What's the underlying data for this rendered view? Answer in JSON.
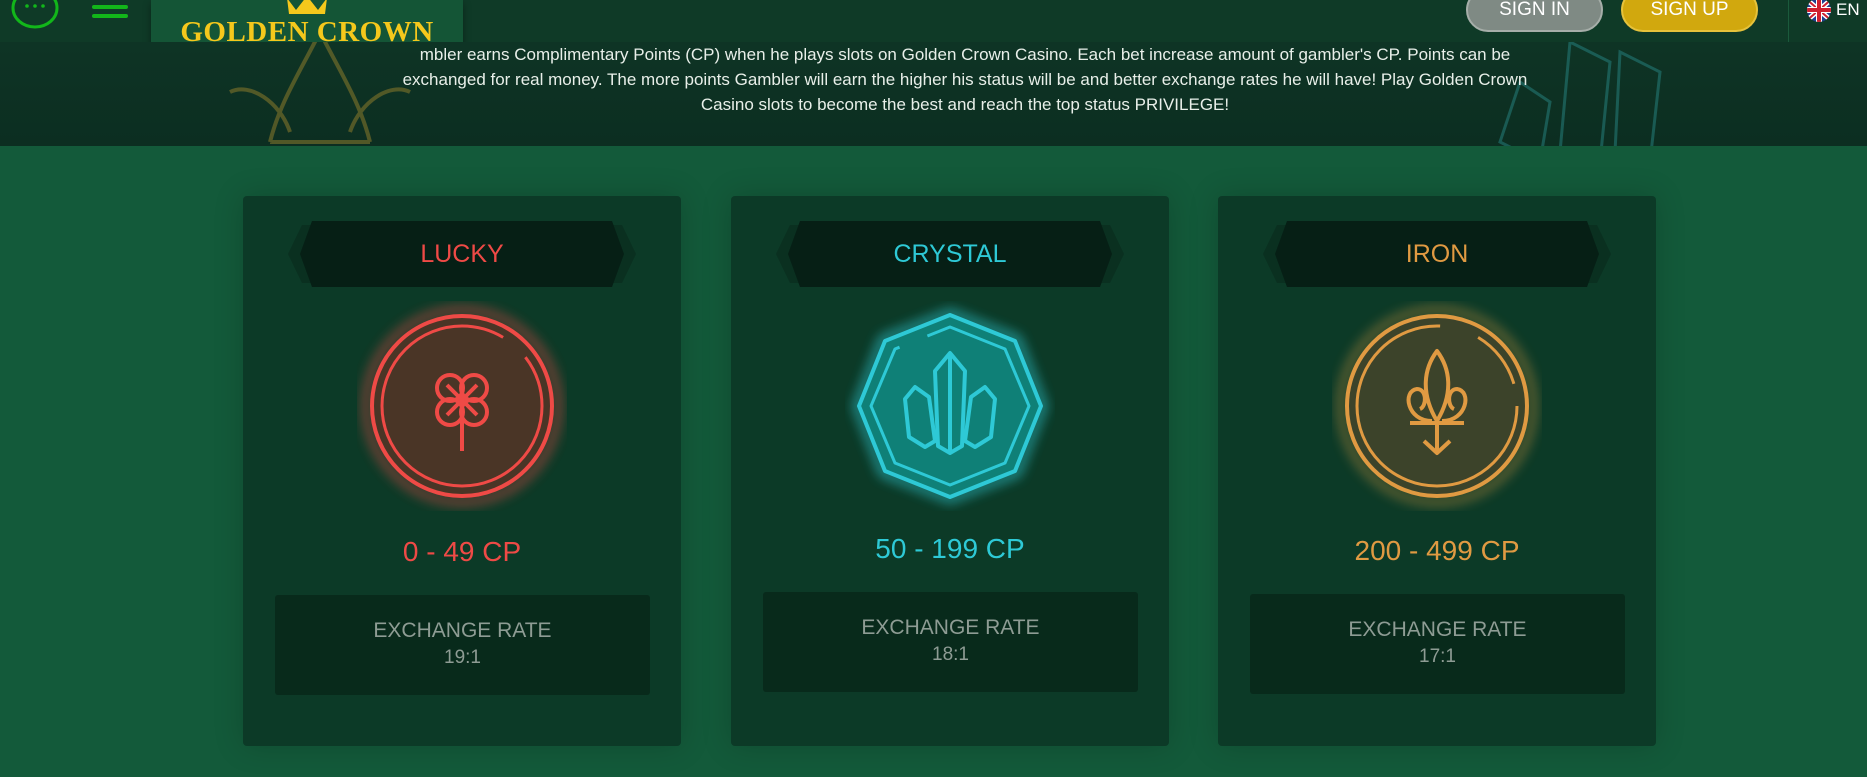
{
  "header": {
    "logo_text": "GOLDEN CROWN",
    "signin_label": "SIGN IN",
    "signup_label": "SIGN UP",
    "language": "EN"
  },
  "intro_text": "mbler earns Complimentary Points (CP) when he plays slots on Golden Crown Casino. Each bet increase amount of gambler's CP. Points can be exchanged for real money. The more points Gambler will earn the higher his status will be and better exchange rates he will have! Play Golden Crown Casino slots to become the best and reach the top status PRIVILEGE!",
  "levels": [
    {
      "name": "LUCKY",
      "range": "0 - 49 CP",
      "rate_label": "EXCHANGE RATE",
      "rate": "19:1",
      "color": "#ef4a46",
      "icon": "clover-icon"
    },
    {
      "name": "CRYSTAL",
      "range": "50 - 199 CP",
      "rate_label": "EXCHANGE RATE",
      "rate": "18:1",
      "color": "#2ec9d6",
      "icon": "crystal-icon"
    },
    {
      "name": "IRON",
      "range": "200 - 499 CP",
      "rate_label": "EXCHANGE RATE",
      "rate": "17:1",
      "color": "#e09a42",
      "icon": "fleur-de-lis-icon"
    }
  ],
  "colors": {
    "background": "#135a3a",
    "card": "#0c3a27",
    "brand_gold": "#f5c81c",
    "menu_green": "#12b61a"
  }
}
